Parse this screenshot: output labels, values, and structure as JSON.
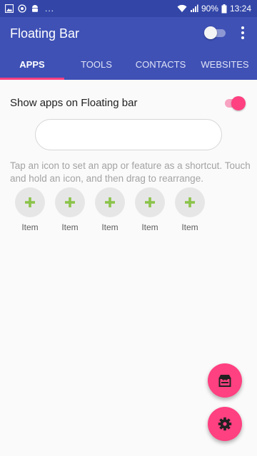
{
  "status_bar": {
    "battery": "90%",
    "time": "13:24",
    "notif_overflow": "..."
  },
  "app_bar": {
    "title": "Floating Bar",
    "enable_toggle_state": "off"
  },
  "tabs": [
    {
      "label": "APPS",
      "active": true
    },
    {
      "label": "TOOLS",
      "active": false
    },
    {
      "label": "CONTACTS",
      "active": false
    },
    {
      "label": "WEBSITES",
      "active": false
    }
  ],
  "apps_section": {
    "toggle_label": "Show apps on Floating bar",
    "toggle_state": "on",
    "hint": "Tap an icon to set an app or feature as a shortcut. Touch and hold an icon, and then drag to rearrange.",
    "items": [
      {
        "label": "Item",
        "icon": "plus-icon"
      },
      {
        "label": "Item",
        "icon": "plus-icon"
      },
      {
        "label": "Item",
        "icon": "plus-icon"
      },
      {
        "label": "Item",
        "icon": "plus-icon"
      },
      {
        "label": "Item",
        "icon": "plus-icon"
      }
    ]
  },
  "fabs": [
    {
      "icon": "store-icon"
    },
    {
      "icon": "settings-gear-icon"
    }
  ],
  "colors": {
    "primary": "#3f51b5",
    "status_bar": "#3346a8",
    "accent": "#ff4081",
    "plus_green": "#8bc34a"
  }
}
